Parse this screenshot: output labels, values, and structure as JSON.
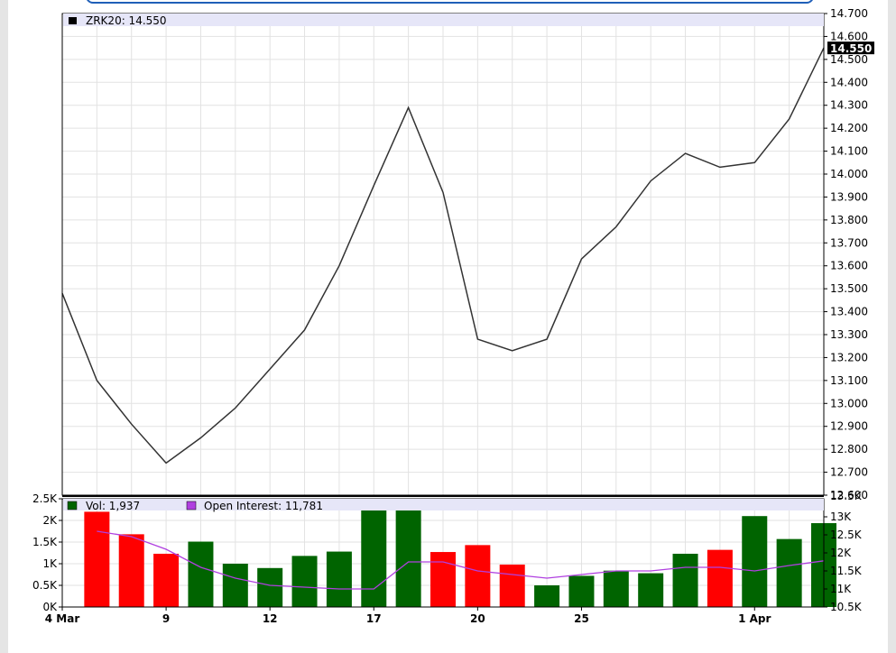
{
  "chart_data": [
    {
      "type": "line",
      "symbol": "ZRK20",
      "last_value": "14.550",
      "legend": "ZRK20: 14.550",
      "line_color": "#000000",
      "x_labels": [
        "4 Mar",
        "9",
        "12",
        "17",
        "20",
        "25",
        "1 Apr"
      ],
      "dates": [
        "Mar 4",
        "Mar 5",
        "Mar 6",
        "Mar 9",
        "Mar 10",
        "Mar 11",
        "Mar 12",
        "Mar 13",
        "Mar 16",
        "Mar 17",
        "Mar 18",
        "Mar 19",
        "Mar 20",
        "Mar 23",
        "Mar 24",
        "Mar 25",
        "Mar 26",
        "Mar 27",
        "Mar 30",
        "Mar 31",
        "Apr 1",
        "Apr 2",
        "Apr 3"
      ],
      "values": [
        13.48,
        13.1,
        12.91,
        12.74,
        12.85,
        12.98,
        13.15,
        13.32,
        13.6,
        13.95,
        14.29,
        13.92,
        13.28,
        13.23,
        13.28,
        13.63,
        13.77,
        13.97,
        14.09,
        14.03,
        14.05,
        14.24,
        14.55
      ],
      "y_ticks": [
        "14.700",
        "14.600",
        "14.500",
        "14.400",
        "14.300",
        "14.200",
        "14.100",
        "14.000",
        "13.900",
        "13.800",
        "13.700",
        "13.600",
        "13.500",
        "13.400",
        "13.300",
        "13.200",
        "13.100",
        "13.000",
        "12.900",
        "12.800",
        "12.700",
        "12.600"
      ],
      "ylim": [
        12.6,
        14.7
      ],
      "grid": true
    },
    {
      "type": "bar",
      "volume_legend": "Vol: 1,937",
      "oi_legend": "Open Interest: 11,781",
      "volume_color_up": "#006400",
      "volume_color_down": "#ff0000",
      "oi_color": "#b040e0",
      "dates": [
        "Mar 5",
        "Mar 6",
        "Mar 9",
        "Mar 10",
        "Mar 11",
        "Mar 12",
        "Mar 13",
        "Mar 16",
        "Mar 17",
        "Mar 18",
        "Mar 19",
        "Mar 20",
        "Mar 23",
        "Mar 24",
        "Mar 25",
        "Mar 26",
        "Mar 27",
        "Mar 30",
        "Mar 31",
        "Apr 1",
        "Apr 2",
        "Apr 3"
      ],
      "volume": [
        2200,
        1680,
        1230,
        1510,
        1000,
        900,
        1180,
        1280,
        2400,
        2350,
        1270,
        1430,
        980,
        500,
        720,
        840,
        780,
        1230,
        1320,
        2100,
        1570,
        1937
      ],
      "volume_color": [
        "down",
        "down",
        "down",
        "up",
        "up",
        "up",
        "up",
        "up",
        "up",
        "up",
        "down",
        "down",
        "down",
        "up",
        "up",
        "up",
        "up",
        "up",
        "down",
        "up",
        "up",
        "up"
      ],
      "open_interest": [
        12600,
        12450,
        12100,
        11600,
        11300,
        11100,
        11050,
        11000,
        11000,
        11750,
        11750,
        11500,
        11400,
        11300,
        11400,
        11500,
        11500,
        11600,
        11600,
        11500,
        11650,
        11781
      ],
      "vol_ticks": [
        "2.5K",
        "2K",
        "1.5K",
        "1K",
        "0.5K",
        "0K"
      ],
      "vol_ylim": [
        0,
        2500
      ],
      "oi_ticks": [
        "13K",
        "12.5K",
        "12K",
        "11.5K",
        "11K",
        "10.5K"
      ],
      "oi_top_label": "13.5K",
      "oi_ylim": [
        10500,
        13500
      ]
    }
  ]
}
